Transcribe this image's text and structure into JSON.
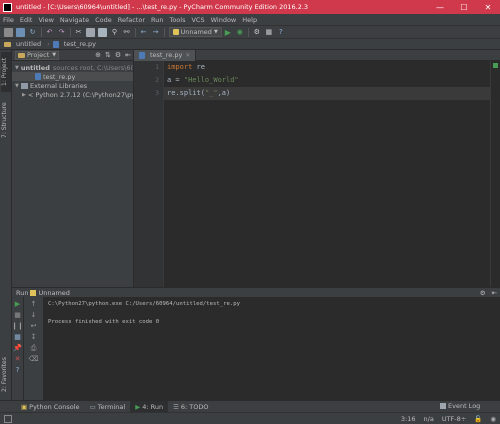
{
  "window": {
    "title": "untitled - [C:\\Users\\60964\\untitled] - ...\\test_re.py - PyCharm Community Edition 2016.2.3",
    "minimize": "—",
    "maximize": "☐",
    "close": "✕"
  },
  "menu": [
    "File",
    "Edit",
    "View",
    "Navigate",
    "Code",
    "Refactor",
    "Run",
    "Tools",
    "VCS",
    "Window",
    "Help"
  ],
  "toolbar": {
    "run_config": "Unnamed"
  },
  "navbar": {
    "project": "untitled",
    "file": "test_re.py"
  },
  "left_stripe": {
    "project_tab": "1: Project",
    "structure_tab": "7: Structure",
    "favorites_tab": "2: Favorites"
  },
  "project_panel": {
    "selector": "Project",
    "tree": [
      {
        "label": "untitled",
        "suffix": "sources root, C:\\Users\\60",
        "kind": "folder",
        "indent": 0,
        "expanded": true
      },
      {
        "label": "test_re.py",
        "suffix": "",
        "kind": "pyfile",
        "indent": 2,
        "expanded": null
      },
      {
        "label": "External Libraries",
        "suffix": "",
        "kind": "lib",
        "indent": 0,
        "expanded": true
      },
      {
        "label": "< Python 2.7.12 (C:\\Python27\\pyt",
        "suffix": "",
        "kind": "lib",
        "indent": 1,
        "expanded": false
      }
    ]
  },
  "editor": {
    "tab_label": "test_re.py",
    "line_numbers": [
      "1",
      "2",
      "3"
    ],
    "code_lines": [
      [
        {
          "t": "import",
          "c": "kw"
        },
        {
          "t": " re",
          "c": ""
        }
      ],
      [
        {
          "t": "a = ",
          "c": ""
        },
        {
          "t": "\"Hello_World\"",
          "c": "str"
        }
      ],
      [
        {
          "t": "re.split(",
          "c": ""
        },
        {
          "t": "\"_\"",
          "c": "str"
        },
        {
          "t": ",a)",
          "c": ""
        }
      ]
    ]
  },
  "run_panel": {
    "title": "Run",
    "config": "Unnamed",
    "console_lines": [
      "C:\\Python27\\python.exe C:/Users/60964/untitled/test_re.py",
      "",
      "Process finished with exit code 0"
    ]
  },
  "bottom_tabs": [
    {
      "label": "Python Console",
      "icon": "python-icon",
      "active": false
    },
    {
      "label": "Terminal",
      "icon": "terminal-icon",
      "active": false
    },
    {
      "label": "4: Run",
      "icon": "run-icon",
      "active": true
    },
    {
      "label": "6: TODO",
      "icon": "todo-icon",
      "active": false
    }
  ],
  "status": {
    "event_log": "Event Log",
    "position": "3:16",
    "line_sep": "n/a",
    "encoding": "UTF-8",
    "encoding_suffix": "÷"
  },
  "colors": {
    "titlebar": "#d0394b",
    "keyword": "#cc7832",
    "string": "#6a8759",
    "run_green": "#499c54"
  }
}
